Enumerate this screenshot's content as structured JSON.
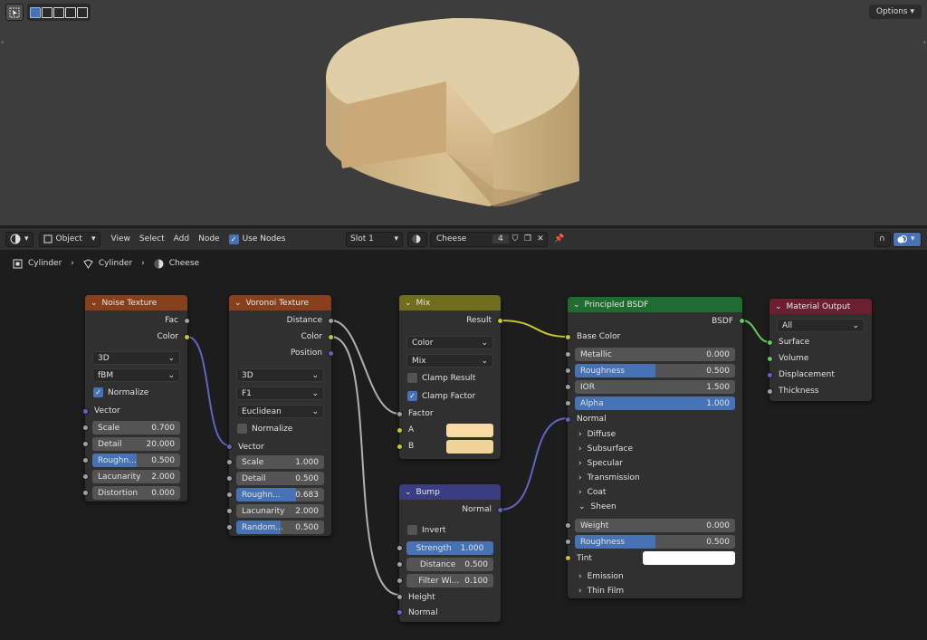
{
  "viewport": {
    "options_label": "Options"
  },
  "header": {
    "object_mode": "Object",
    "menu": [
      "View",
      "Select",
      "Add",
      "Node"
    ],
    "use_nodes_label": "Use Nodes",
    "slot": "Slot 1",
    "material_name": "Cheese",
    "user_count": "4"
  },
  "breadcrumb": [
    "Cylinder",
    "Cylinder",
    "Cheese"
  ],
  "colors": {
    "texture": "#883f1b",
    "converter": "#6e6e1d",
    "vector": "#3c3c83",
    "shader": "#1f6b30",
    "output": "#6b1f30",
    "accent": "#4772b3"
  },
  "noise": {
    "title": "Noise Texture",
    "out_fac": "Fac",
    "out_color": "Color",
    "dim": "3D",
    "type": "fBM",
    "normalize": "Normalize",
    "in_vector": "Vector",
    "scale_l": "Scale",
    "scale_v": "0.700",
    "detail_l": "Detail",
    "detail_v": "20.000",
    "rough_l": "Roughn...",
    "rough_v": "0.500",
    "lac_l": "Lacunarity",
    "lac_v": "2.000",
    "dist_l": "Distortion",
    "dist_v": "0.000"
  },
  "voronoi": {
    "title": "Voronoi Texture",
    "out_distance": "Distance",
    "out_color": "Color",
    "out_position": "Position",
    "dim": "3D",
    "feature": "F1",
    "metric": "Euclidean",
    "normalize": "Normalize",
    "in_vector": "Vector",
    "scale_l": "Scale",
    "scale_v": "1.000",
    "detail_l": "Detail",
    "detail_v": "0.500",
    "rough_l": "Roughn...",
    "rough_v": "0.683",
    "lac_l": "Lacunarity",
    "lac_v": "2.000",
    "rand_l": "Random...",
    "rand_v": "0.500"
  },
  "mix": {
    "title": "Mix",
    "out_result": "Result",
    "data_type": "Color",
    "blend": "Mix",
    "clamp_result": "Clamp Result",
    "clamp_factor": "Clamp Factor",
    "in_factor": "Factor",
    "in_a": "A",
    "in_b": "B",
    "a_color": "#f9d9a6",
    "b_color": "#f2d49a"
  },
  "bump": {
    "title": "Bump",
    "out_normal": "Normal",
    "invert": "Invert",
    "strength_l": "Strength",
    "strength_v": "1.000",
    "distance_l": "Distance",
    "distance_v": "0.500",
    "filter_l": "Filter Wi...",
    "filter_v": "0.100",
    "in_height": "Height",
    "in_normal": "Normal"
  },
  "bsdf": {
    "title": "Principled BSDF",
    "out_bsdf": "BSDF",
    "base_color": "Base Color",
    "metallic_l": "Metallic",
    "metallic_v": "0.000",
    "rough_l": "Roughness",
    "rough_v": "0.500",
    "ior_l": "IOR",
    "ior_v": "1.500",
    "alpha_l": "Alpha",
    "alpha_v": "1.000",
    "normal": "Normal",
    "panels": [
      "Diffuse",
      "Subsurface",
      "Specular",
      "Transmission",
      "Coat"
    ],
    "sheen": "Sheen",
    "weight_l": "Weight",
    "weight_v": "0.000",
    "sheen_rough_l": "Roughness",
    "sheen_rough_v": "0.500",
    "tint_l": "Tint",
    "panels2": [
      "Emission",
      "Thin Film"
    ]
  },
  "output": {
    "title": "Material Output",
    "target": "All",
    "surface": "Surface",
    "volume": "Volume",
    "displacement": "Displacement",
    "thickness": "Thickness"
  }
}
